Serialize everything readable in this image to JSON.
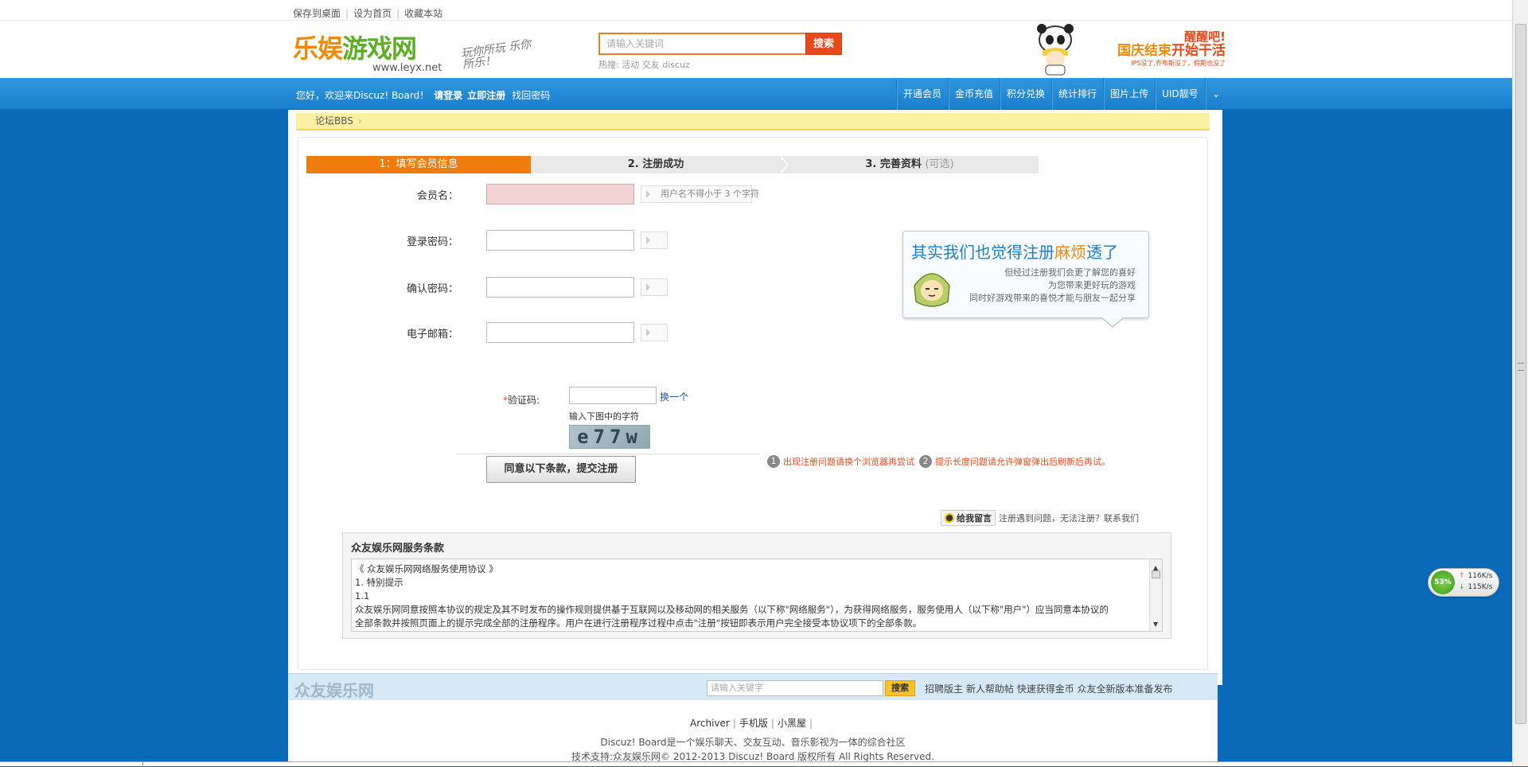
{
  "top_links": [
    "保存到桌面",
    "设为首页",
    "收藏本站"
  ],
  "logo": {
    "main_orange": "乐娱",
    "main_green": "游戏网",
    "url": "www.leyx.net",
    "slogan": "玩你所玩 乐你所乐！"
  },
  "search": {
    "placeholder": "请输入关键词",
    "button": "搜索",
    "hot_label": "热搜:",
    "hot_items": [
      "活动",
      "交友",
      "discuz"
    ]
  },
  "promo": {
    "line1": "醒醒吧!",
    "line2a": "国庆结束",
    "line2b": "开始干活",
    "line3": "IPS没了,乔布斯没了，假期也没了"
  },
  "nav": {
    "welcome": "您好，欢迎来Discuz! Board！",
    "login": "请登录",
    "register": "立即注册",
    "recover": "找回密码",
    "right_items": [
      "开通会员",
      "金币充值",
      "积分兑换",
      "统计排行",
      "图片上传",
      "UID靓号"
    ]
  },
  "breadcrumb": {
    "item": "论坛BBS",
    "sep": "›"
  },
  "steps": {
    "s1": "1：填写会员信息",
    "s2": "2. 注册成功",
    "s3": "3. 完善资料",
    "s3_opt": "(可选)"
  },
  "form": {
    "username_label": "会员名：",
    "username_hint": "用户名不得小于 3 个字符",
    "password_label": "登录密码：",
    "confirm_label": "确认密码：",
    "email_label": "电子邮箱："
  },
  "tip": {
    "title_a": "其实我们也觉得注册",
    "title_b": "麻烦",
    "title_c": "透了",
    "line1": "但经过注册我们会更了解您的喜好",
    "line2": "为您带来更好玩的游戏",
    "line3": "同时好游戏带来的喜悦才能与朋友一起分享"
  },
  "captcha": {
    "star": "*",
    "label": "验证码:",
    "change": "换一个",
    "hint": "输入下图中的字符",
    "image_text": "e77w"
  },
  "submit": {
    "label": "同意以下条款，提交注册"
  },
  "warnings": {
    "n1": "1",
    "t1": "出现注册问题请换个浏览器再尝试",
    "n2": "2",
    "t2": "提示长度问题请允许弹窗弹出后刷新后再试。"
  },
  "contact": {
    "button": "给我留言",
    "text": "注册遇到问题，无法注册？联系我们"
  },
  "terms": {
    "title": "众友娱乐网服务条款",
    "lines": [
      "《 众友娱乐网网络服务使用协议 》",
      "1. 特别提示",
      "1.1",
      "众友娱乐网同意按照本协议的规定及其不时发布的操作规则提供基于互联网以及移动网的相关服务（以下称\"网络服务\"），为获得网络服务，服务使用人（以下称\"用户\"）应当同意本协议的",
      "全部条款并按照页面上的提示完成全部的注册程序。用户在进行注册程序过程中点击\"注册\"按钮即表示用户完全接受本协议项下的全部条款。"
    ]
  },
  "footer": {
    "brand": "众友娱乐网",
    "search_placeholder": "请输入关键字",
    "search_button": "搜索",
    "links": [
      "招聘版主",
      "新人帮助帖",
      "快速获得金币",
      "众友全新版本准备发布"
    ],
    "bottom_links": [
      "Archiver",
      "手机版",
      "小黑屋"
    ],
    "line1": "Discuz! Board是一个娱乐聊天、交友互动、音乐影视为一体的综合社区",
    "line2": "技术支持:众友娱乐网© 2012-2013 Discuz! Board 版权所有 All Rights Reserved."
  },
  "speed_widget": {
    "percent": "53%",
    "up": "116K/s",
    "down": "115K/s"
  }
}
